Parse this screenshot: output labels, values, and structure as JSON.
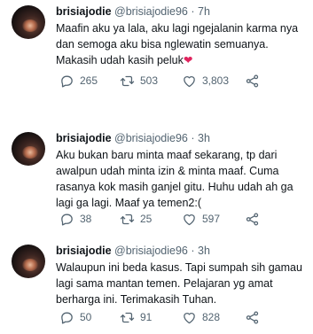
{
  "tweets": [
    {
      "display_name": "brisiajodie",
      "handle": "@brisiajodie96",
      "separator": "·",
      "time": "7h",
      "text": "Maafin aku ya lala, aku lagi ngejalanin karma nya dan semoga aku bisa nglewatin semuanya. Makasih udah kasih peluk",
      "emoji": "❤",
      "replies": "265",
      "retweets": "503",
      "likes": "3,803"
    },
    {
      "display_name": "brisiajodie",
      "handle": "@brisiajodie96",
      "separator": "·",
      "time": "3h",
      "text": "Aku bukan baru minta maaf sekarang, tp dari awalpun udah minta izin & minta maaf. Cuma rasanya kok masih ganjel gitu. Huhu udah ah ga lagi ga lagi. Maaf ya temen2:(",
      "replies": "38",
      "retweets": "25",
      "likes": "597"
    },
    {
      "display_name": "brisiajodie",
      "handle": "@brisiajodie96",
      "separator": "·",
      "time": "3h",
      "text": "Walaupun ini beda kasus. Tapi sumpah sih gamau lagi sama mantan temen. Pelajaran yg amat berharga ini. Terimakasih Tuhan.",
      "replies": "50",
      "retweets": "91",
      "likes": "828"
    }
  ],
  "colors": {
    "text": "#0f1419",
    "secondary": "#536471",
    "heart": "#e0245e"
  },
  "icons": [
    "reply-icon",
    "retweet-icon",
    "like-icon",
    "share-icon"
  ]
}
